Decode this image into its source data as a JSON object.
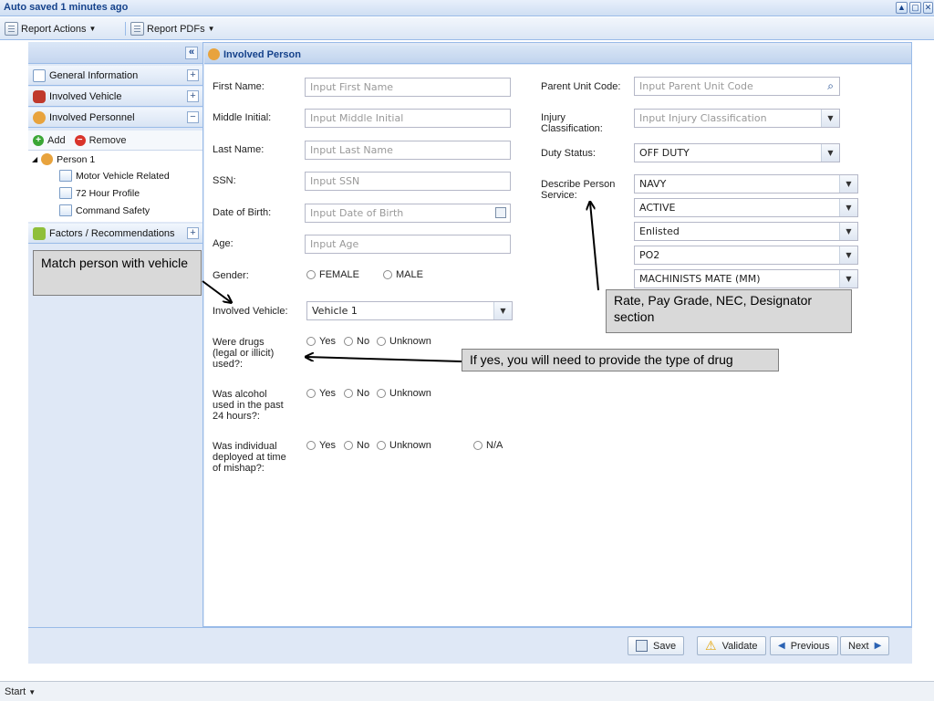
{
  "window": {
    "title": "Auto saved 1 minutes ago",
    "controls": [
      "▲",
      "▢",
      "✕"
    ]
  },
  "toolbar": {
    "report_actions": "Report Actions",
    "report_pdfs": "Report PDFs"
  },
  "sidebar": {
    "collapse": "«",
    "sections": [
      {
        "label": "General Information",
        "toggle": "+",
        "icon": "document-icon"
      },
      {
        "label": "Involved Vehicle",
        "toggle": "+",
        "icon": "car-icon"
      },
      {
        "label": "Involved Personnel",
        "toggle": "−",
        "icon": "people-icon"
      },
      {
        "label": "Factors / Recommendations",
        "toggle": "+",
        "icon": "puzzle-icon"
      }
    ],
    "add_label": "Add",
    "remove_label": "Remove",
    "tree": {
      "person": "Person 1",
      "children": [
        "Motor Vehicle Related",
        "72 Hour Profile",
        "Command Safety"
      ]
    }
  },
  "panel": {
    "title": "Involved Person"
  },
  "form": {
    "first_name": {
      "label": "First Name:",
      "placeholder": "Input First Name"
    },
    "middle_initial": {
      "label": "Middle Initial:",
      "placeholder": "Input Middle Initial"
    },
    "last_name": {
      "label": "Last Name:",
      "placeholder": "Input Last Name"
    },
    "ssn": {
      "label": "SSN:",
      "placeholder": "Input SSN"
    },
    "dob": {
      "label": "Date of Birth:",
      "placeholder": "Input Date of Birth"
    },
    "age": {
      "label": "Age:",
      "placeholder": "Input Age"
    },
    "gender": {
      "label": "Gender:",
      "options": [
        "FEMALE",
        "MALE"
      ]
    },
    "involved_vehicle": {
      "label": "Involved Vehicle:",
      "value": "Vehicle 1"
    },
    "drugs": {
      "label_lines": [
        "Were drugs",
        "(legal or illicit)",
        "used?:"
      ],
      "options": [
        "Yes",
        "No",
        "Unknown"
      ]
    },
    "alcohol": {
      "label_lines": [
        "Was alcohol",
        "used in the past",
        "24 hours?:"
      ],
      "options": [
        "Yes",
        "No",
        "Unknown"
      ]
    },
    "deployed": {
      "label_lines": [
        "Was individual",
        "deployed at time",
        "of mishap?:"
      ],
      "options": [
        "Yes",
        "No",
        "Unknown",
        "N/A"
      ]
    },
    "parent_unit": {
      "label": "Parent Unit Code:",
      "placeholder": "Input Parent Unit Code"
    },
    "injury": {
      "label_lines": [
        "Injury",
        "Classification:"
      ],
      "placeholder": "Input Injury Classification"
    },
    "duty_status": {
      "label": "Duty Status:",
      "value": "OFF DUTY"
    },
    "person_service": {
      "label_lines": [
        "Describe Person",
        "Service:"
      ],
      "values": [
        "NAVY",
        "ACTIVE",
        "Enlisted",
        "PO2",
        "MACHINISTS MATE (MM)"
      ]
    }
  },
  "annotations": {
    "match": "Match person with vehicle",
    "rate": "Rate, Pay Grade, NEC, Designator section",
    "drugs": "If yes, you will need to provide the type of drug"
  },
  "footer": {
    "save": "Save",
    "validate": "Validate",
    "previous": "Previous",
    "next": "Next"
  },
  "taskbar": {
    "start": "Start"
  },
  "colors": {
    "frame_blue": "#99bbe8",
    "title_text": "#15428b",
    "callout_bg": "#d9d9d9"
  }
}
